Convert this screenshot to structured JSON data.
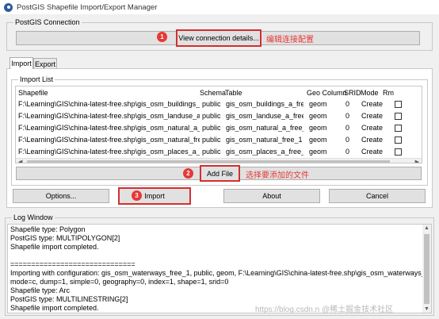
{
  "window": {
    "title": "PostGIS Shapefile Import/Export Manager"
  },
  "connection": {
    "group_title": "PostGIS Connection",
    "button_label": "View connection details...",
    "badge": "1",
    "annotation": "编辑连接配置"
  },
  "tabs": [
    {
      "label": "Import",
      "active": true
    },
    {
      "label": "Export",
      "active": false
    }
  ],
  "import_list": {
    "group_title": "Import List",
    "columns": [
      "Shapefile",
      "Schema",
      "Table",
      "Geo Column",
      "SRID",
      "Mode",
      "Rm"
    ],
    "rows": [
      {
        "shapefile": "F:\\Learning\\GIS\\china-latest-free.shp\\gis_osm_buildings_a_free",
        "schema": "public",
        "table": "gis_osm_buildings_a_free_1",
        "geo_column": "geom",
        "srid": "0",
        "mode": "Create"
      },
      {
        "shapefile": "F:\\Learning\\GIS\\china-latest-free.shp\\gis_osm_landuse_a_free_1",
        "schema": "public",
        "table": "gis_osm_landuse_a_free_1",
        "geo_column": "geom",
        "srid": "0",
        "mode": "Create"
      },
      {
        "shapefile": "F:\\Learning\\GIS\\china-latest-free.shp\\gis_osm_natural_a_free_1.",
        "schema": "public",
        "table": "gis_osm_natural_a_free_1",
        "geo_column": "geom",
        "srid": "0",
        "mode": "Create"
      },
      {
        "shapefile": "F:\\Learning\\GIS\\china-latest-free.shp\\gis_osm_natural_free_1.sh",
        "schema": "public",
        "table": "gis_osm_natural_free_1",
        "geo_column": "geom",
        "srid": "0",
        "mode": "Create"
      },
      {
        "shapefile": "F:\\Learning\\GIS\\china-latest-free.shp\\gis_osm_places_a_free_1.",
        "schema": "public",
        "table": "gis_osm_places_a_free_1",
        "geo_column": "geom",
        "srid": "0",
        "mode": "Create"
      }
    ]
  },
  "add_file": {
    "label": "Add File",
    "badge": "2",
    "annotation": "选择要添加的文件"
  },
  "actions": {
    "options_label": "Options...",
    "import_label": "Import",
    "import_badge": "3",
    "about_label": "About",
    "cancel_label": "Cancel"
  },
  "log": {
    "group_title": "Log Window",
    "lines": [
      "Shapefile type: Polygon",
      "PostGIS type: MULTIPOLYGON[2]",
      "Shapefile import completed.",
      "",
      "==============================",
      "Importing with configuration: gis_osm_waterways_free_1, public, geom, F:\\Learning\\GIS\\china-latest-free.shp\\gis_osm_waterways_free_1.shp,",
      "mode=c, dump=1, simple=0, geography=0, index=1, shape=1, srid=0",
      "Shapefile type: Arc",
      "PostGIS type: MULTILINESTRING[2]",
      "Shapefile import completed."
    ]
  },
  "watermark": "https://blog.csdn.n @稀土掘金技术社区"
}
